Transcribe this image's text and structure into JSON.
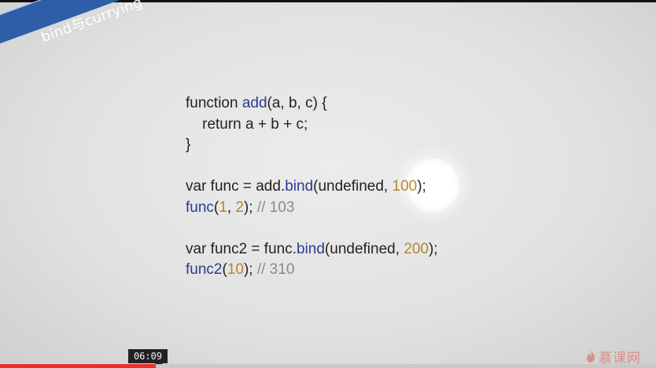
{
  "slide": {
    "ribbon_label": "bind与currying",
    "colors": {
      "ribbon": "#2e5ea8",
      "function_name": "#2b3a94",
      "number": "#b4862a",
      "comment": "#8a8a8a"
    },
    "code_lines": [
      [
        {
          "t": "function "
        },
        {
          "t": "add",
          "c": "fn"
        },
        {
          "t": "(a, b, c) {"
        }
      ],
      [
        {
          "t": "    return a + b + c;"
        }
      ],
      [
        {
          "t": "}"
        }
      ],
      [],
      [
        {
          "t": "var func = add."
        },
        {
          "t": "bind",
          "c": "fn"
        },
        {
          "t": "(undefined, "
        },
        {
          "t": "100",
          "c": "num"
        },
        {
          "t": ");"
        }
      ],
      [
        {
          "t": "func",
          "c": "fn"
        },
        {
          "t": "("
        },
        {
          "t": "1",
          "c": "num"
        },
        {
          "t": ", "
        },
        {
          "t": "2",
          "c": "num"
        },
        {
          "t": "); "
        },
        {
          "t": "// 103",
          "c": "cm"
        }
      ],
      [],
      [
        {
          "t": "var func2 = func."
        },
        {
          "t": "bind",
          "c": "fn"
        },
        {
          "t": "(undefined, "
        },
        {
          "t": "200",
          "c": "num"
        },
        {
          "t": ");"
        }
      ],
      [
        {
          "t": "func2",
          "c": "fn"
        },
        {
          "t": "("
        },
        {
          "t": "10",
          "c": "num"
        },
        {
          "t": "); "
        },
        {
          "t": "// 310",
          "c": "cm"
        }
      ]
    ]
  },
  "player": {
    "current_time": "06:09",
    "progress_fraction": 0.237,
    "progress_color": "#e8312d",
    "watermark": "慕课网"
  }
}
